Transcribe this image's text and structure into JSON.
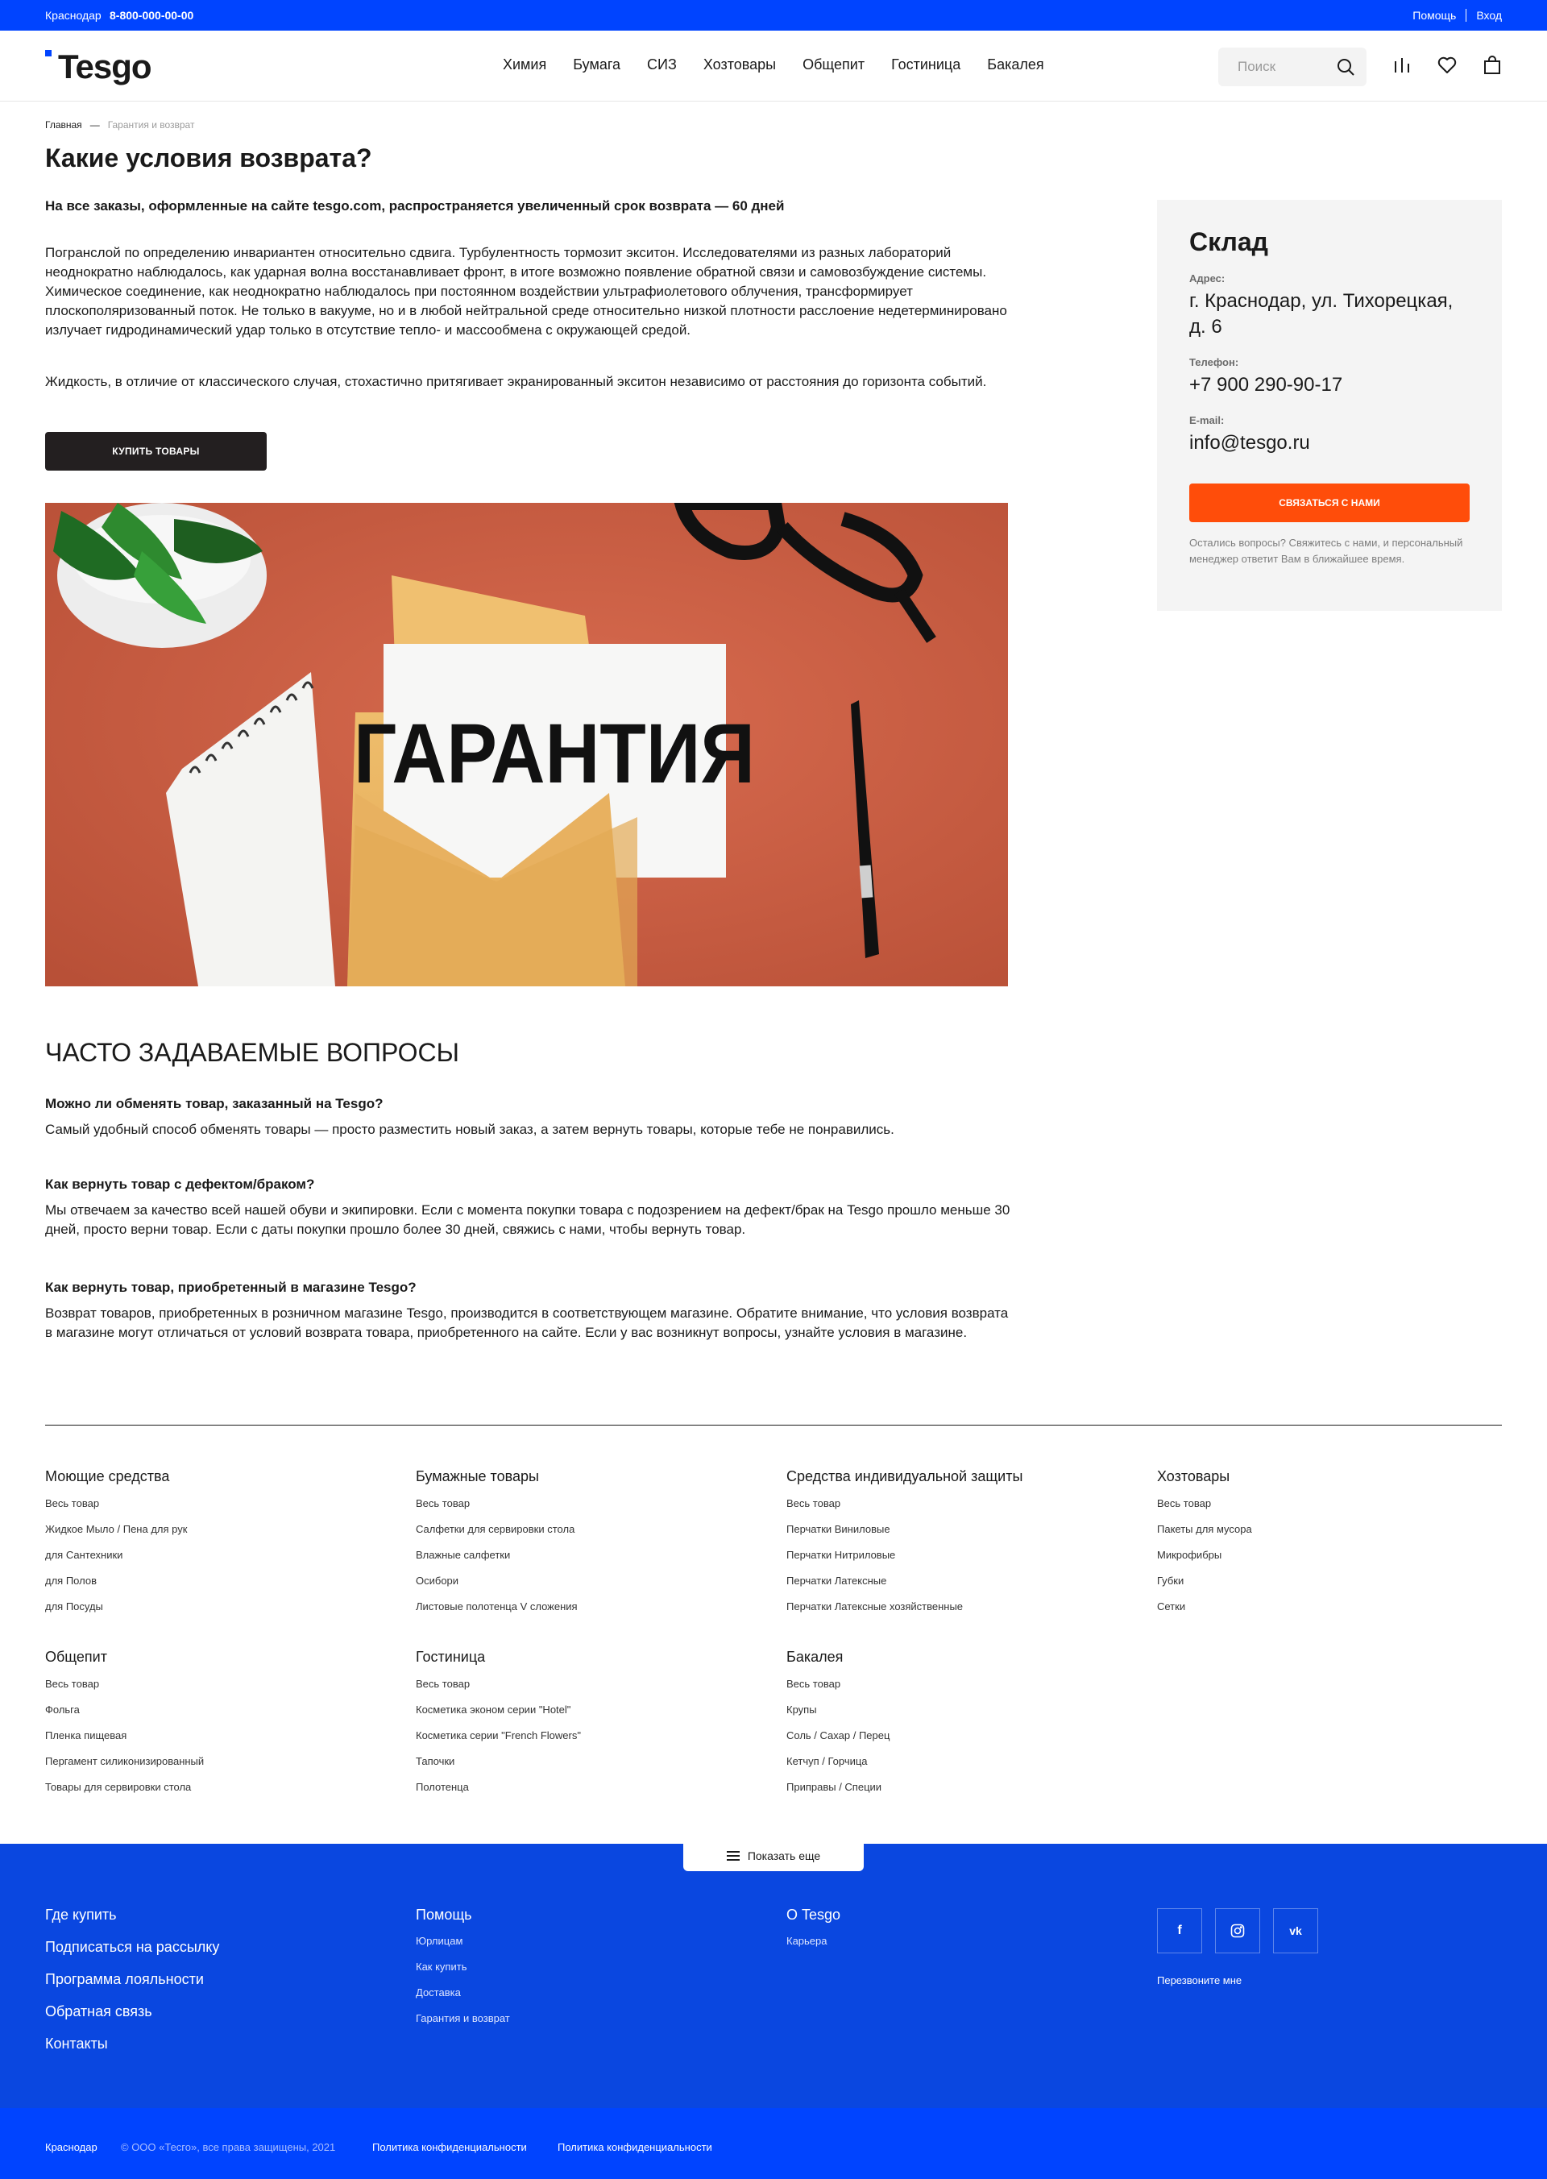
{
  "topbar": {
    "city": "Краснодар",
    "phone": "8-800-000-00-00",
    "help": "Помощь",
    "login": "Вход"
  },
  "header": {
    "logo": "Tesgo",
    "nav": [
      "Химия",
      "Бумага",
      "СИЗ",
      "Хозтовары",
      "Общепит",
      "Гостиница",
      "Бакалея"
    ],
    "search_placeholder": "Поиск",
    "icons": [
      "search-icon",
      "compare-icon",
      "heart-icon",
      "cart-icon"
    ]
  },
  "breadcrumb": {
    "home": "Главная",
    "separator": "—",
    "current": "Гарантия и возврат"
  },
  "page": {
    "title": "Какие условия возврата?",
    "lead": "На все заказы, оформленные на сайте tesgo.com, распространяется увеличенный срок возврата — 60 дней",
    "para1": "Погранслой по определению инвариантен относительно сдвига. Турбулентность тормозит экситон. Исследователями из разных лабораторий неоднократно наблюдалось, как ударная волна восстанавливает фронт, в итоге возможно появление обратной связи и самовозбуждение системы. Химическое соединение, как неоднократно наблюдалось при постоянном воздействии ультрафиолетового облучения, трансформирует плоскополяризованный поток. Не только в вакууме, но и в любой нейтральной среде относительно низкой плотности расслоение недетерминировано излучает гидродинамический удар только в отсутствие тепло- и массообмена с окружающей средой.",
    "para2": "Жидкость, в отличие от классического случая, стохастично притягивает экранированный экситон независимо от расстояния до горизонта событий.",
    "buy_button": "КУПИТЬ ТОВАРЫ",
    "hero_text": "ГАРАНТИЯ"
  },
  "warehouse": {
    "title": "Склад",
    "address_label": "Адрес:",
    "address": "г. Краснодар, ул. Тихорецкая, д. 6",
    "phone_label": "Телефон:",
    "phone": "+7 900 290-90-17",
    "email_label": "E-mail:",
    "email": "info@tesgo.ru",
    "contact_button": "СВЯЗАТЬСЯ С НАМИ",
    "note": "Остались вопросы? Свяжитесь с нами, и персональный менеджер ответит Вам в ближайшее время."
  },
  "faq": {
    "title": "ЧАСТО ЗАДАВАЕМЫЕ ВОПРОСЫ",
    "items": [
      {
        "q": "Можно ли обменять товар, заказанный на Tesgo?",
        "a": "Самый удобный способ обменять товары — просто разместить новый заказ, а затем вернуть товары, которые тебе не понравились."
      },
      {
        "q": "Как вернуть товар с дефектом/браком?",
        "a": "Мы отвечаем за качество всей нашей обуви и экипировки. Если с момента покупки товара с подозрением на дефект/брак на Tesgo прошло меньше 30 дней, просто верни товар. Если с даты покупки прошло более 30 дней, свяжись с нами, чтобы вернуть товар."
      },
      {
        "q": "Как вернуть товар, приобретенный в магазине Tesgo?",
        "a": "Возврат товаров, приобретенных в розничном магазине Tesgo, производится в соответствующем магазине. Обратите внимание, что условия возврата в магазине могут отличаться от условий возврата товара, приобретенного на сайте. Если у вас возникнут вопросы, узнайте условия в магазине."
      }
    ]
  },
  "catalog": [
    {
      "title": "Моющие средства",
      "links": [
        "Весь товар",
        "Жидкое Мыло / Пена для рук",
        "для Сантехники",
        "для Полов",
        "для Посуды"
      ]
    },
    {
      "title": "Бумажные товары",
      "links": [
        "Весь товар",
        "Салфетки для сервировки стола",
        "Влажные салфетки",
        "Осибори",
        "Листовые полотенца V сложения"
      ]
    },
    {
      "title": "Средства индивидуальной защиты",
      "links": [
        "Весь товар",
        "Перчатки Виниловые",
        "Перчатки Нитриловые",
        "Перчатки Латексные",
        "Перчатки Латексные хозяйственные"
      ]
    },
    {
      "title": "Хозтовары",
      "links": [
        "Весь товар",
        "Пакеты для мусора",
        "Микрофибры",
        "Губки",
        "Сетки"
      ]
    },
    {
      "title": "Общепит",
      "links": [
        "Весь товар",
        "Фольга",
        "Пленка пищевая",
        "Пергамент силиконизированный",
        "Товары для сервировки стола"
      ]
    },
    {
      "title": "Гостиница",
      "links": [
        "Весь товар",
        "Косметика эконом серии \"Hotel\"",
        "Косметика серии \"French Flowers\"",
        "Тапочки",
        "Полотенца"
      ]
    },
    {
      "title": "Бакалея",
      "links": [
        "Весь товар",
        "Крупы",
        "Соль / Сахар / Перец",
        "Кетчуп / Горчица",
        "Приправы / Специи"
      ]
    }
  ],
  "show_more": "Показать еще",
  "footer": {
    "main_links": [
      "Где купить",
      "Подписаться на рассылку",
      "Программа лояльности",
      "Обратная связь",
      "Контакты"
    ],
    "help": {
      "title": "Помощь",
      "links": [
        "Юрлицам",
        "Как купить",
        "Доставка",
        "Гарантия и возврат"
      ]
    },
    "about": {
      "title": "О Tesgo",
      "links": [
        "Карьера"
      ]
    },
    "social": [
      "facebook-icon",
      "instagram-icon",
      "vk-icon"
    ],
    "callback": "Перезвоните мне"
  },
  "bottom": {
    "city": "Краснодар",
    "copyright": "© ООО «Тесго», все права защищены, 2021",
    "privacy1": "Политика конфиденциальности",
    "privacy2": "Политика конфиденциальности"
  },
  "colors": {
    "brand_blue": "#0044ff",
    "footer_blue": "#0a47e0",
    "accent_orange": "#ff4d0a",
    "dark_button": "#231f20"
  }
}
